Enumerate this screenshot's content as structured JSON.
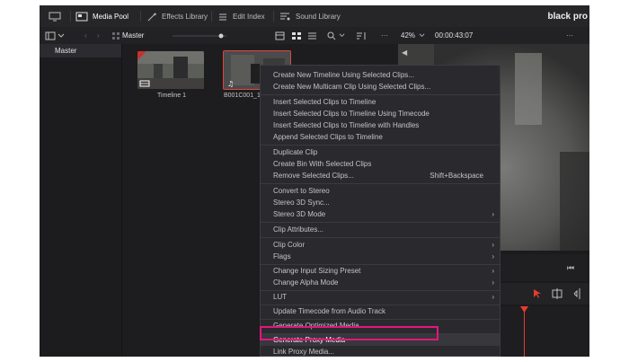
{
  "topbar": {
    "media_pool": "Media Pool",
    "effects_library": "Effects Library",
    "edit_index": "Edit Index",
    "sound_library": "Sound Library",
    "brand": "black pro"
  },
  "toolbar": {
    "bin_label": "Master",
    "zoom": "42%",
    "timecode": "00:00:43:07"
  },
  "left_pane": {
    "master": "Master"
  },
  "clips": [
    {
      "label": "Timeline 1"
    },
    {
      "label": "B001C001_1..."
    }
  ],
  "context_menu": {
    "items": [
      {
        "label": "Create New Timeline Using Selected Clips...",
        "dim": false
      },
      {
        "label": "Create New Multicam Clip Using Selected Clips...",
        "dim": false
      },
      {
        "label": "Insert Selected Clips to Timeline",
        "dim": true
      },
      {
        "label": "Insert Selected Clips to Timeline Using Timecode",
        "dim": false
      },
      {
        "label": "Insert Selected Clips to Timeline with Handles",
        "dim": false
      },
      {
        "label": "Append Selected Clips to Timeline",
        "dim": false
      },
      {
        "label": "Duplicate Clip",
        "dim": false
      },
      {
        "label": "Create Bin With Selected Clips",
        "dim": false
      },
      {
        "label": "Remove Selected Clips...",
        "dim": false,
        "shortcut": "Shift+Backspace"
      },
      {
        "label": "Convert to Stereo",
        "dim": false
      },
      {
        "label": "Stereo 3D Sync...",
        "dim": false
      },
      {
        "label": "Stereo 3D Mode",
        "dim": false,
        "submenu": true
      },
      {
        "label": "Clip Attributes...",
        "dim": false
      },
      {
        "label": "Clip Color",
        "dim": false,
        "submenu": true
      },
      {
        "label": "Flags",
        "dim": false,
        "submenu": true
      },
      {
        "label": "Change Input Sizing Preset",
        "dim": false,
        "submenu": true
      },
      {
        "label": "Change Alpha Mode",
        "dim": false,
        "submenu": true
      },
      {
        "label": "LUT",
        "dim": false,
        "submenu": true
      },
      {
        "label": "Update Timecode from Audio Track",
        "dim": false
      },
      {
        "label": "Generate Optimized Media",
        "dim": false
      },
      {
        "label": "Generate Proxy Media",
        "dim": false
      },
      {
        "label": "Link Proxy Media...",
        "dim": false
      }
    ]
  },
  "colors": {
    "accent_highlight": "#e5157d",
    "playhead": "#e63b2e",
    "menu_bg": "#2a2a2e"
  }
}
